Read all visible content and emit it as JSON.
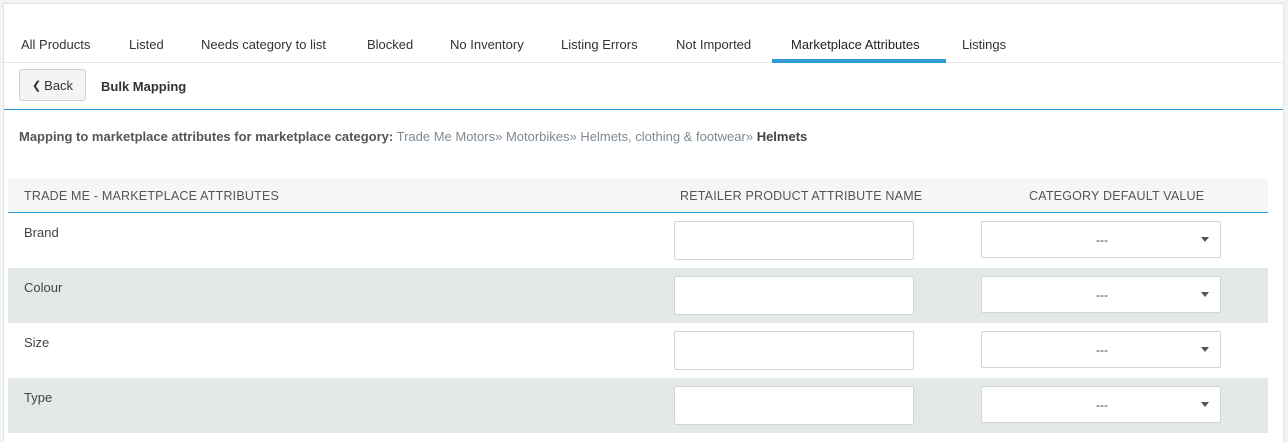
{
  "tabs": [
    {
      "label": "All Products"
    },
    {
      "label": "Listed"
    },
    {
      "label": "Needs category to list"
    },
    {
      "label": "Blocked"
    },
    {
      "label": "No Inventory"
    },
    {
      "label": "Listing Errors"
    },
    {
      "label": "Not Imported"
    },
    {
      "label": "Marketplace Attributes",
      "active": true
    },
    {
      "label": "Listings"
    }
  ],
  "subbar": {
    "back_label": "Back",
    "title": "Bulk Mapping"
  },
  "mapping": {
    "label": "Mapping to marketplace attributes for marketplace category:",
    "crumbs": "Trade Me Motors» Motorbikes» Helmets, clothing & footwear»",
    "leaf": "Helmets"
  },
  "table": {
    "headers": {
      "marketplace": "TRADE ME - MARKETPLACE ATTRIBUTES",
      "retailer": "RETAILER PRODUCT ATTRIBUTE NAME",
      "default": "CATEGORY DEFAULT VALUE"
    },
    "rows": [
      {
        "name": "Brand",
        "retailer_value": "",
        "default_value": "---"
      },
      {
        "name": "Colour",
        "retailer_value": "",
        "default_value": "---"
      },
      {
        "name": "Size",
        "retailer_value": "",
        "default_value": "---"
      },
      {
        "name": "Type",
        "retailer_value": "",
        "default_value": "---"
      }
    ]
  },
  "colors": {
    "accent": "#2e9ad8",
    "row_alt": "#e2e9e6"
  }
}
